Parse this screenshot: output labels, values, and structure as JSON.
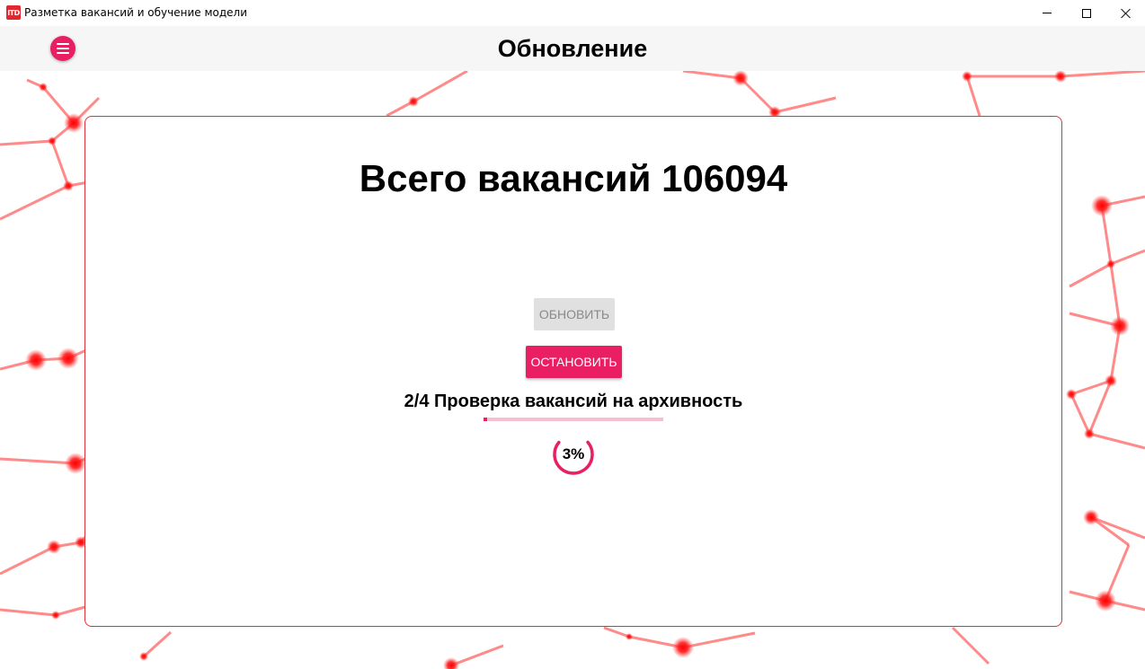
{
  "window": {
    "title": "Разметка вакансий и обучение модели",
    "icon": "app-logo-icon",
    "icon_text": "ITD"
  },
  "header": {
    "title": "Обновление",
    "menu_icon": "hamburger-menu-icon"
  },
  "card": {
    "total_text": "Всего вакансий 106094",
    "update_button": "ОБНОВИТЬ",
    "stop_button": "ОСТАНОВИТЬ",
    "step_text": "2/4 Проверка вакансий на архивность",
    "step_progress_fraction": 0.02,
    "percent_value": 3,
    "percent_text": "3%"
  },
  "colors": {
    "accent": "#e91e63",
    "disabled_bg": "#e0e0e0",
    "card_border": "#e0303a",
    "network": "#ff1a1a"
  }
}
